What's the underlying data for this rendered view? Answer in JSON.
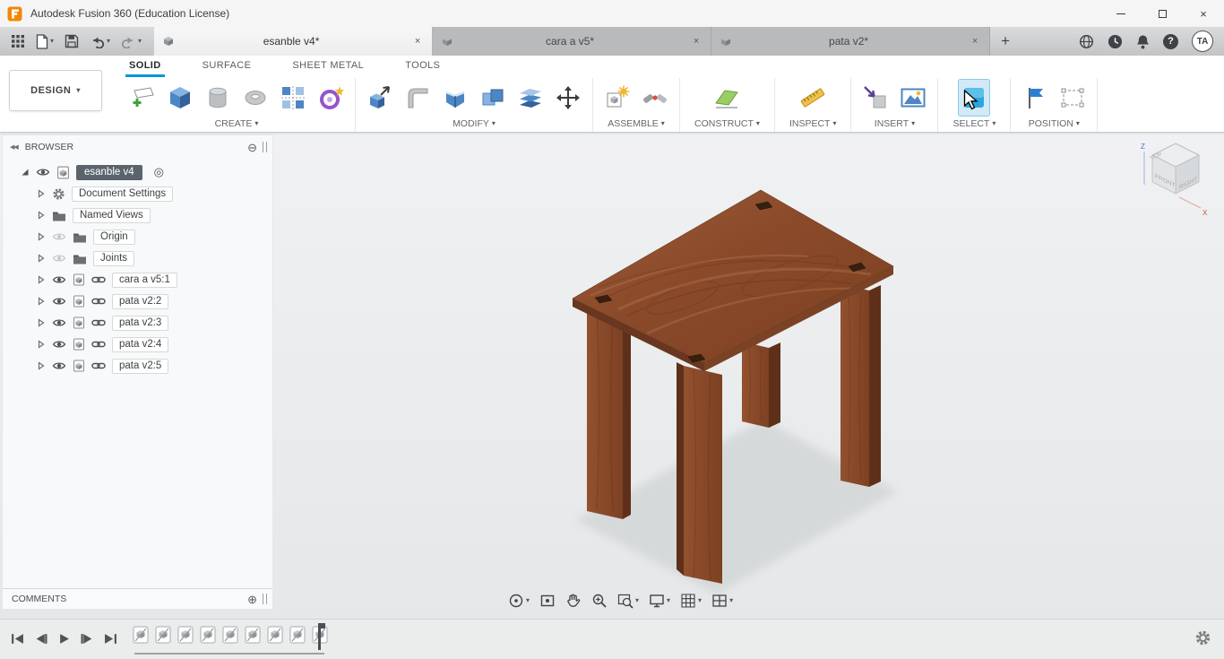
{
  "titlebar": {
    "title": "Autodesk Fusion 360 (Education License)"
  },
  "icons": {
    "caret": "▾",
    "close": "×",
    "new_tab": "+",
    "collapse_left": "◀◀",
    "remove_circle": "⊖",
    "add_circle": "⊕",
    "target": "◎",
    "help": "?"
  },
  "workspace": {
    "label": "DESIGN"
  },
  "doc_tabs": [
    {
      "label": "esanble v4*"
    },
    {
      "label": "cara a v5*"
    },
    {
      "label": "pata v2*"
    }
  ],
  "ribbon_tabs": [
    {
      "label": "SOLID"
    },
    {
      "label": "SURFACE"
    },
    {
      "label": "SHEET METAL"
    },
    {
      "label": "TOOLS"
    }
  ],
  "groups": [
    {
      "label": "CREATE"
    },
    {
      "label": "MODIFY"
    },
    {
      "label": "ASSEMBLE"
    },
    {
      "label": "CONSTRUCT"
    },
    {
      "label": "INSPECT"
    },
    {
      "label": "INSERT"
    },
    {
      "label": "SELECT"
    },
    {
      "label": "POSITION"
    }
  ],
  "browser": {
    "header": "BROWSER",
    "root_label": "esanble v4",
    "items": [
      {
        "label": "Document Settings"
      },
      {
        "label": "Named Views"
      },
      {
        "label": "Origin"
      },
      {
        "label": "Joints"
      },
      {
        "label": "cara a v5:1"
      },
      {
        "label": "pata v2:2"
      },
      {
        "label": "pata v2:3"
      },
      {
        "label": "pata v2:4"
      },
      {
        "label": "pata v2:5"
      }
    ],
    "comments": "COMMENTS"
  },
  "viewcube": {
    "top": "TOP",
    "front": "FRONT",
    "right": "RIGHT",
    "z": "Z",
    "x": "X"
  },
  "account": {
    "initials": "TA"
  },
  "colors": {
    "accent": "#0696d7",
    "wood": "#8a4a2a",
    "wood_dark": "#5e3019",
    "canvas": "#eceef0",
    "select_active_bg": "#d2e9f8"
  }
}
